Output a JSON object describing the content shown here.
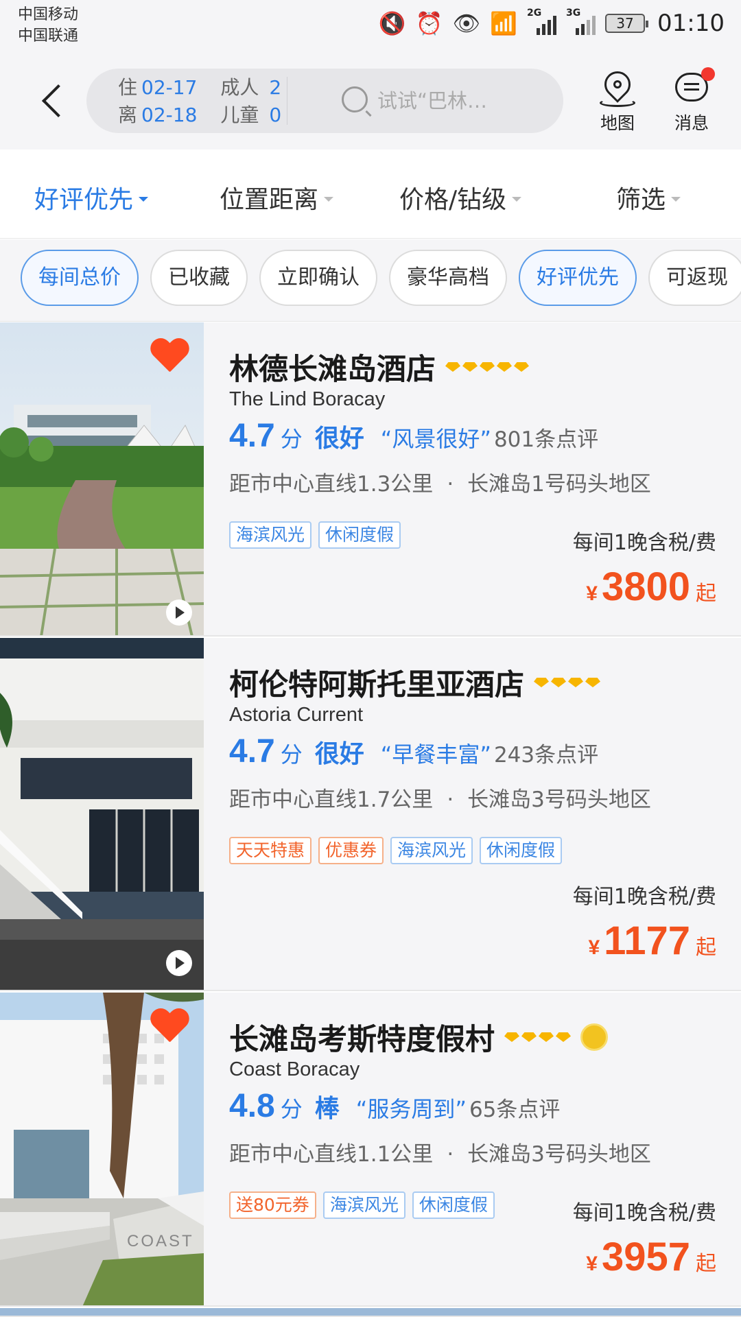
{
  "status_bar": {
    "carrier_1": "中国移动",
    "carrier_2": "中国联通",
    "net_1": "2G",
    "net_2": "3G",
    "battery": "37",
    "time": "01:10"
  },
  "header": {
    "checkin_label": "住",
    "checkin_date": "02-17",
    "checkout_label": "离",
    "checkout_date": "02-18",
    "adults_label": "成人",
    "adults": "2",
    "children_label": "儿童",
    "children": "0",
    "search_placeholder": "试试“巴林…",
    "map_label": "地图",
    "message_label": "消息"
  },
  "sort_tabs": [
    {
      "label": "好评优先",
      "active": true
    },
    {
      "label": "位置距离",
      "active": false
    },
    {
      "label": "价格/钻级",
      "active": false
    },
    {
      "label": "筛选",
      "active": false
    }
  ],
  "chips": [
    {
      "label": "每间总价",
      "selected": true
    },
    {
      "label": "已收藏",
      "selected": false
    },
    {
      "label": "立即确认",
      "selected": false
    },
    {
      "label": "豪华高档",
      "selected": false
    },
    {
      "label": "好评优先",
      "selected": true
    },
    {
      "label": "可返现",
      "selected": false
    }
  ],
  "hotels": [
    {
      "name": "林德长滩岛酒店",
      "name_en": "The Lind Boracay",
      "diamonds": 5,
      "score": "4.7",
      "score_unit": "分",
      "level": "很好",
      "quote": "“风景很好”",
      "reviews": "801条点评",
      "distance": "距市中心直线1.3公里",
      "separator": "·",
      "area": "长滩岛1号码头地区",
      "tags": [
        {
          "text": "海滨风光",
          "tone": "blue"
        },
        {
          "text": "休闲度假",
          "tone": "blue"
        }
      ],
      "price_note": "每间1晚含税/费",
      "currency": "¥",
      "price": "3800",
      "price_suffix": "起",
      "favorited": true
    },
    {
      "name": "柯伦特阿斯托里亚酒店",
      "name_en": "Astoria Current",
      "diamonds": 4,
      "score": "4.7",
      "score_unit": "分",
      "level": "很好",
      "quote": "“早餐丰富”",
      "reviews": "243条点评",
      "distance": "距市中心直线1.7公里",
      "separator": "·",
      "area": "长滩岛3号码头地区",
      "tags": [
        {
          "text": "天天特惠",
          "tone": "orange"
        },
        {
          "text": "优惠券",
          "tone": "orange"
        },
        {
          "text": "海滨风光",
          "tone": "blue"
        },
        {
          "text": "休闲度假",
          "tone": "blue"
        }
      ],
      "price_note": "每间1晚含税/费",
      "currency": "¥",
      "price": "1177",
      "price_suffix": "起",
      "favorited": false
    },
    {
      "name": "长滩岛考斯特度假村",
      "name_en": "Coast Boracay",
      "diamonds": 4,
      "score": "4.8",
      "score_unit": "分",
      "level": "棒",
      "quote": "“服务周到”",
      "reviews": "65条点评",
      "distance": "距市中心直线1.1公里",
      "separator": "·",
      "area": "长滩岛3号码头地区",
      "tags": [
        {
          "text": "送80元券",
          "tone": "orange"
        },
        {
          "text": "海滨风光",
          "tone": "blue"
        },
        {
          "text": "休闲度假",
          "tone": "blue"
        }
      ],
      "price_note": "每间1晚含税/费",
      "currency": "¥",
      "price": "3957",
      "price_suffix": "起",
      "favorited": true,
      "photo_sign": "COAST"
    }
  ],
  "colors": {
    "accent_blue": "#2a7be4",
    "price_orange": "#f2521e",
    "favorite_red": "#ff4a1f",
    "diamond_gold": "#f7b500"
  }
}
